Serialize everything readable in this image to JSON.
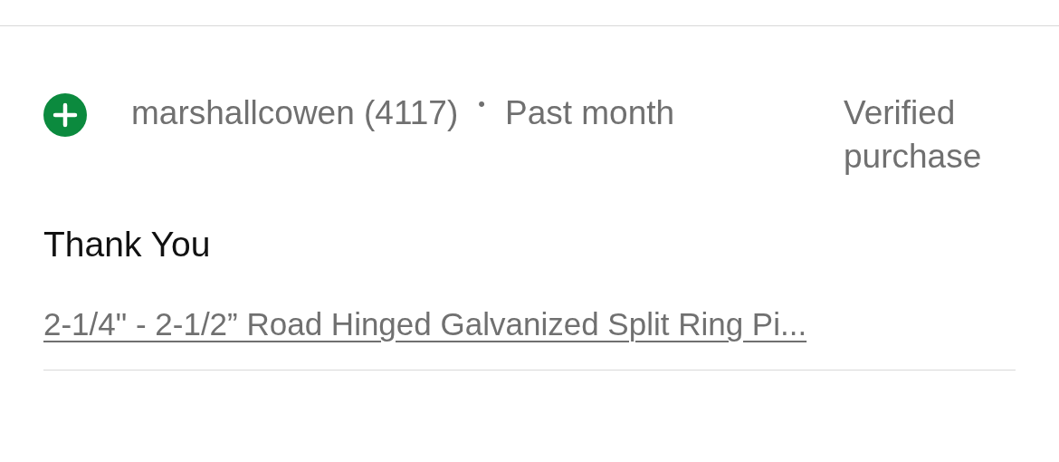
{
  "review": {
    "reviewer": "marshallcowen (4117)",
    "separator": "•",
    "date": "Past month",
    "badge": "Verified purchase",
    "title": "Thank You",
    "item_link": "2-1/4\" - 2-1/2” Road Hinged Galvanized Split Ring Pi..."
  }
}
